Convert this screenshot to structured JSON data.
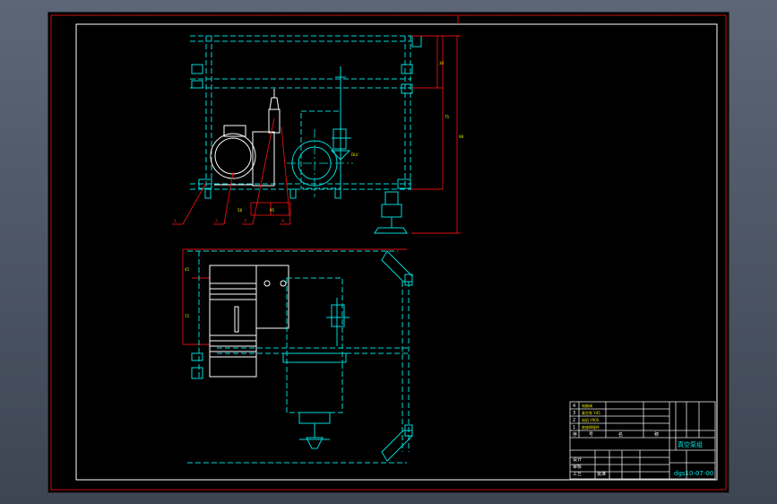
{
  "drawing": {
    "title": "真空泵组",
    "drawing_number": "dgs10-07-00",
    "dimensions": {
      "upper_right_1": "30",
      "upper_right_2": "75",
      "upper_right_3": "98",
      "lower_dim_1": "58",
      "lower_dim_2": "95",
      "left_dim_1": "45",
      "left_dim_2": "72"
    },
    "leaders": [
      "1",
      "2",
      "3",
      "4"
    ],
    "note_label": "DLV",
    "title_block": {
      "rows": [
        {
          "no": "4",
          "name": "电磁阀"
        },
        {
          "no": "3",
          "name": "真空泵 Y45"
        },
        {
          "no": "2",
          "name": "电机 Y90S"
        },
        {
          "no": "1",
          "name": "底座焊接件"
        }
      ],
      "header": [
        "序",
        "号",
        "名",
        "称"
      ],
      "sign_row": [
        "设计",
        "审核",
        "工艺",
        "批准"
      ]
    }
  },
  "colors": {
    "background": "#000000",
    "linework": "#00d8d8",
    "border": "#e01010",
    "title_block": "#e8e8e8",
    "window": "#4a5262"
  }
}
